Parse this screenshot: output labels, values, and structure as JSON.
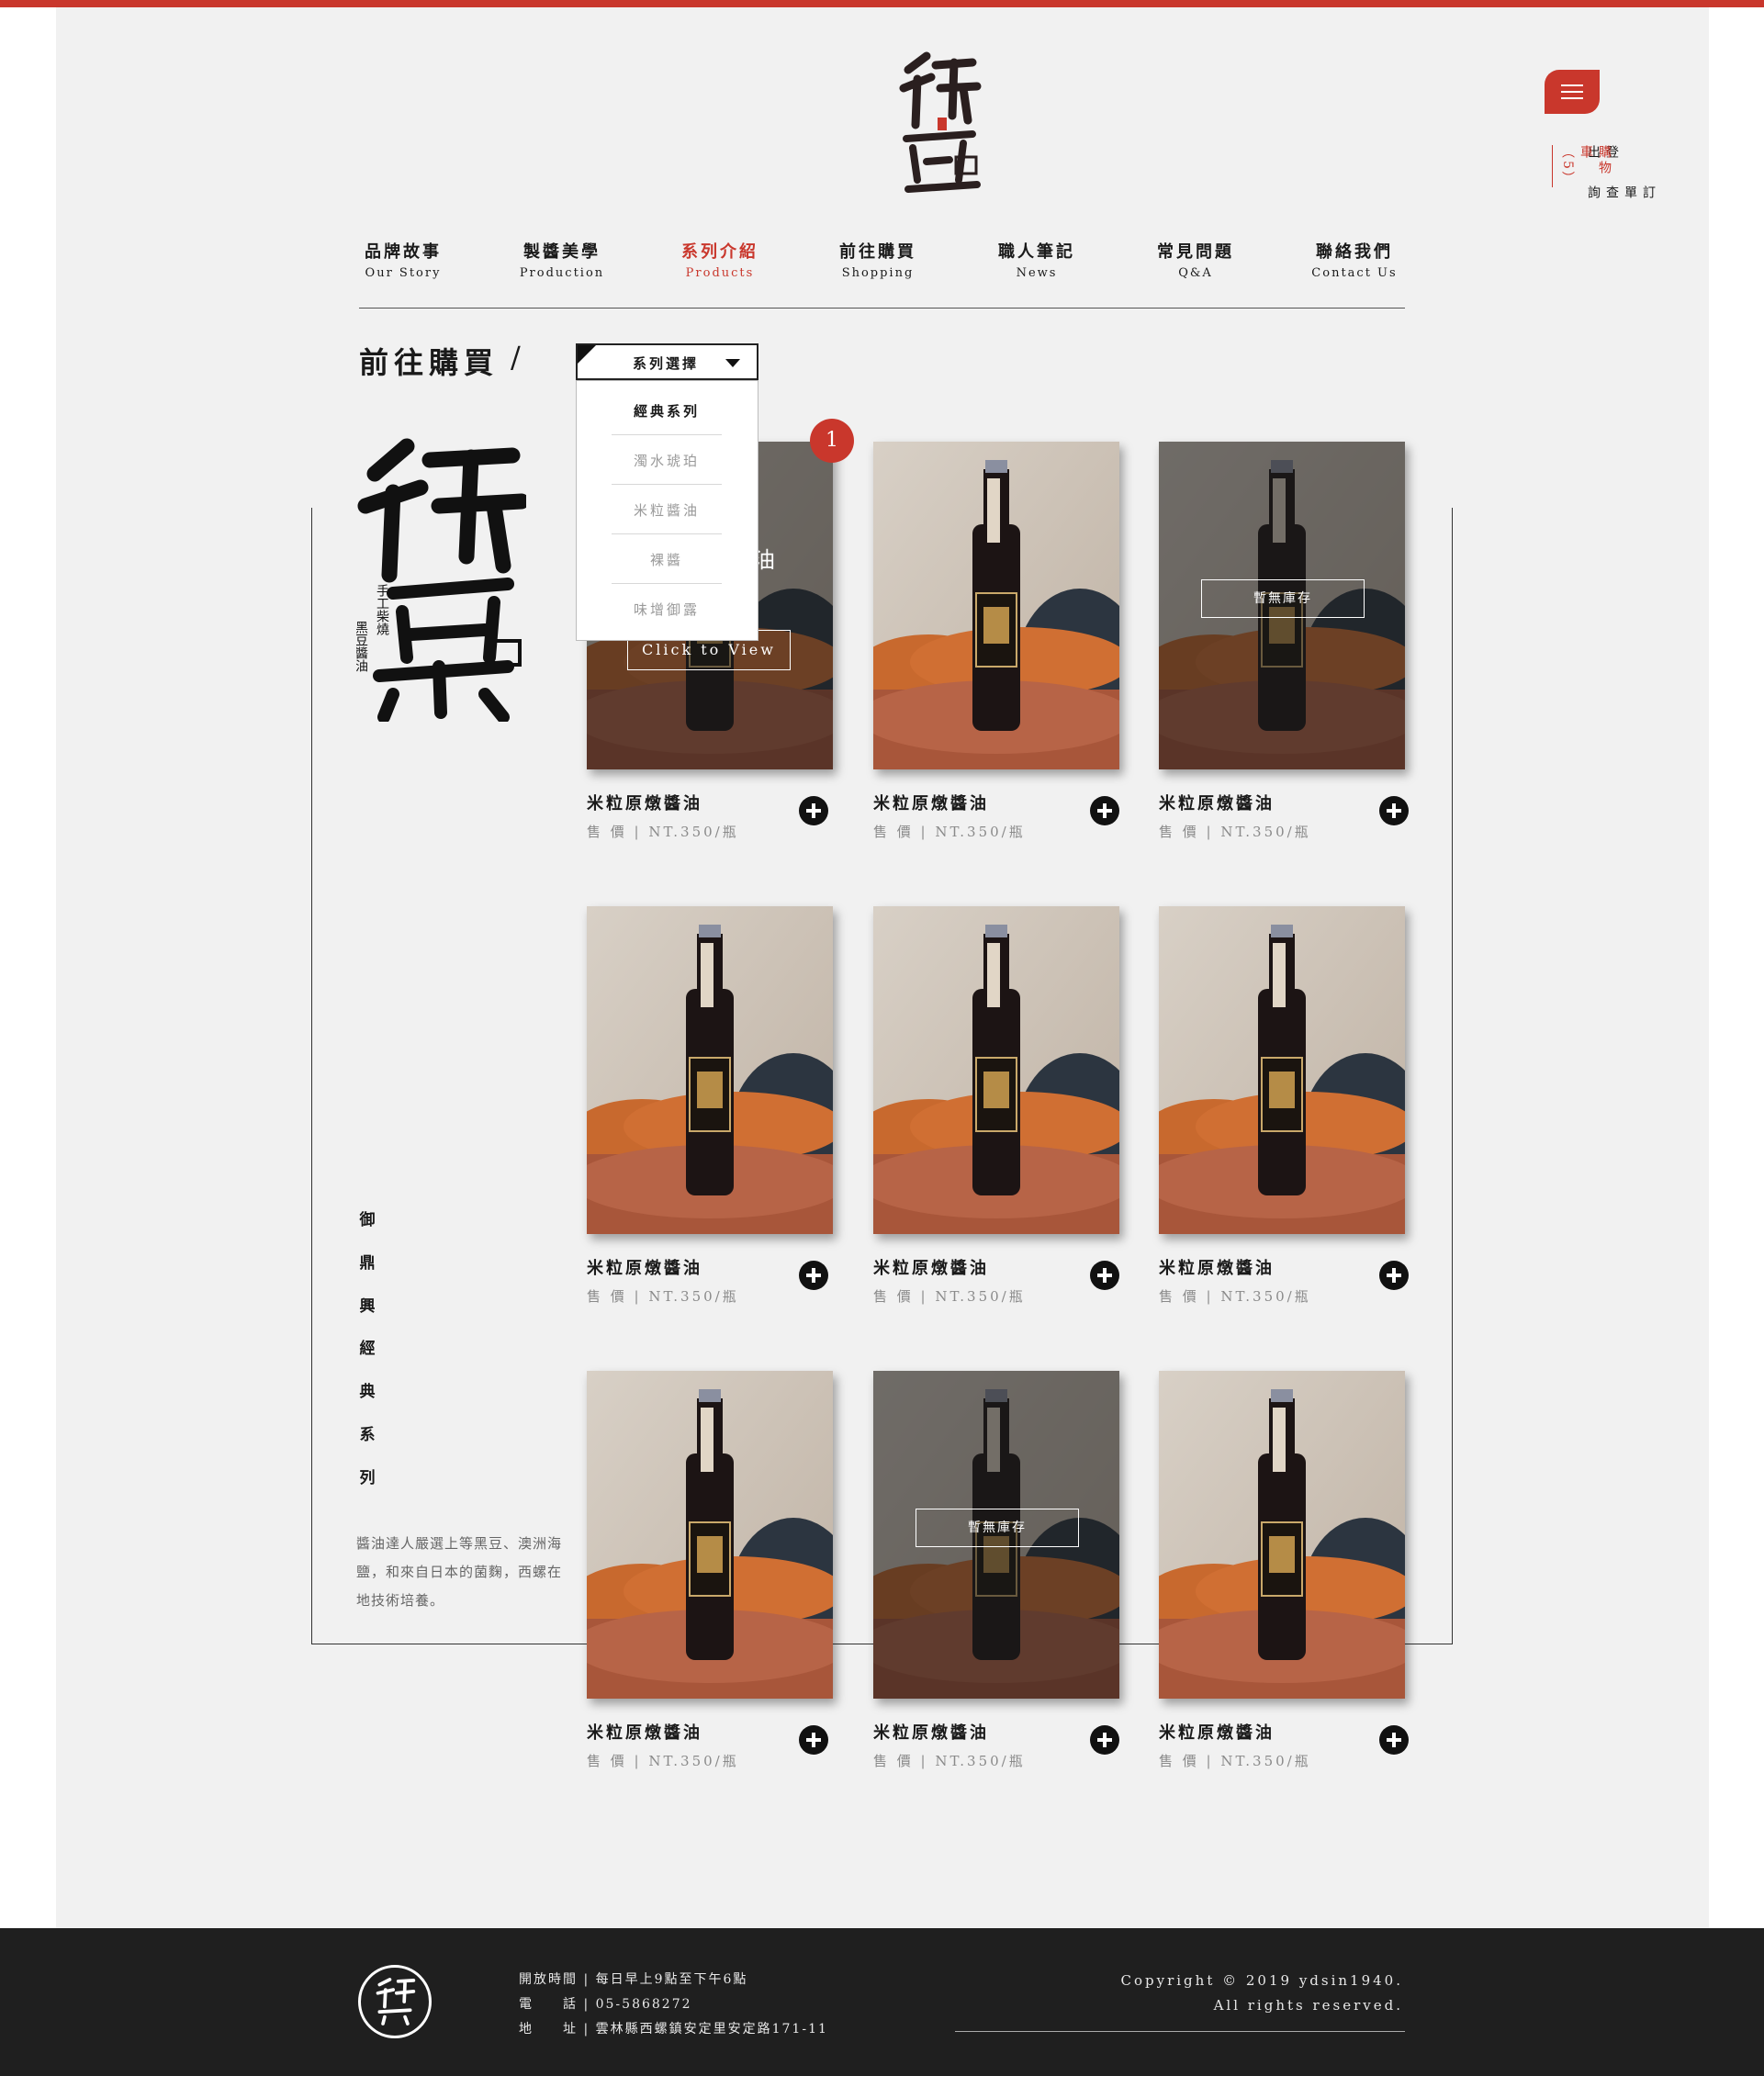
{
  "colors": {
    "accent": "#c9372c",
    "background": "#f1f1f1",
    "footer": "#1f1f1f"
  },
  "brand": {
    "logo_icon": "yudingxing-calligraphy-logo",
    "footer_logo_icon": "yudingxing-round-logo"
  },
  "header": {
    "menu_icon": "hamburger-icon",
    "side_links": {
      "logout": "登出",
      "order_query": "訂單查詢",
      "cart": "購物車（5）"
    }
  },
  "nav": [
    {
      "zh": "品牌故事",
      "en": "Our Story",
      "active": false
    },
    {
      "zh": "製醬美學",
      "en": "Production",
      "active": false
    },
    {
      "zh": "系列介紹",
      "en": "Products",
      "active": true
    },
    {
      "zh": "前往購買",
      "en": "Shopping",
      "active": false
    },
    {
      "zh": "職人筆記",
      "en": "News",
      "active": false
    },
    {
      "zh": "常見問題",
      "en": "Q&A",
      "active": false
    },
    {
      "zh": "聯絡我們",
      "en": "Contact Us",
      "active": false
    }
  ],
  "breadcrumb": {
    "title": "前往購買",
    "separator": "/"
  },
  "dropdown": {
    "label": "系列選擇",
    "options": [
      "經典系列",
      "濁水琥珀",
      "米粒醬油",
      "裸醬",
      "味增御露"
    ],
    "selected": "經典系列"
  },
  "series": {
    "vertical_title": [
      "御",
      "鼎",
      "興",
      "經",
      "典",
      "系",
      "列"
    ],
    "description": "醬油達人嚴選上等黑豆、澳洲海鹽，和來自日本的菌麴，西螺在地技術培養。"
  },
  "cart_badge": "1",
  "hover_card": {
    "title_peek": "油",
    "button": "Click to View"
  },
  "out_of_stock_label": "暫無庫存",
  "products": [
    {
      "name": "米粒原燉醬油",
      "price": "售 價 | NT.350/瓶",
      "stock": "in"
    },
    {
      "name": "米粒原燉醬油",
      "price": "售 價 | NT.350/瓶",
      "stock": "in"
    },
    {
      "name": "米粒原燉醬油",
      "price": "售 價 | NT.350/瓶",
      "stock": "out"
    },
    {
      "name": "米粒原燉醬油",
      "price": "售 價 | NT.350/瓶",
      "stock": "in"
    },
    {
      "name": "米粒原燉醬油",
      "price": "售 價 | NT.350/瓶",
      "stock": "in"
    },
    {
      "name": "米粒原燉醬油",
      "price": "售 價 | NT.350/瓶",
      "stock": "in"
    },
    {
      "name": "米粒原燉醬油",
      "price": "售 價 | NT.350/瓶",
      "stock": "in"
    },
    {
      "name": "米粒原燉醬油",
      "price": "售 價 | NT.350/瓶",
      "stock": "out"
    },
    {
      "name": "米粒原燉醬油",
      "price": "售 價 | NT.350/瓶",
      "stock": "in"
    }
  ],
  "footer": {
    "hours": "開放時間 | 每日早上9點至下午6點",
    "phone": "電　　話 | 05-5868272",
    "address": "地　　址 | 雲林縣西螺鎮安定里安定路171-11",
    "copyright_1": "Copyright © 2019 ydsin1940.",
    "copyright_2": "All rights reserved."
  }
}
